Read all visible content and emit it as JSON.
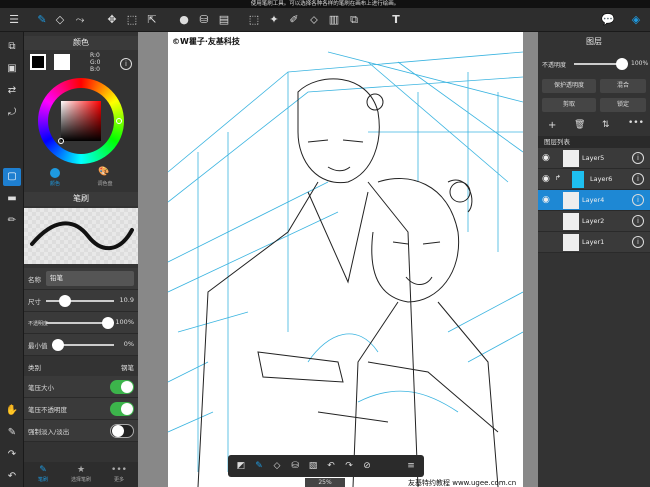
{
  "hint_bar": "使用笔刷工具。可以选择各种各样的笔刷在画布上进行绘画。",
  "toolbar": {
    "menu_icon": "menu-icon",
    "tools": [
      "brush-icon",
      "eraser-icon",
      "smudge-icon",
      "move-icon",
      "transform-icon",
      "export-icon",
      "fill-icon",
      "bucket-icon",
      "gradient-icon",
      "select-rect-icon",
      "magic-wand-icon",
      "select-pen-icon",
      "select-eraser-icon",
      "crop-icon",
      "text-icon"
    ],
    "right": [
      "chat-icon",
      "layers-icon"
    ]
  },
  "color_panel": {
    "title": "颜色",
    "r": "R:0",
    "g": "G:0",
    "b": "B:0",
    "tab_color": "颜色",
    "tab_palette": "调色盘"
  },
  "brush_panel": {
    "title": "笔刷",
    "name_label": "名称",
    "name_value": "铅笔",
    "size_label": "尺寸",
    "size_value": "10.9",
    "size_fraction": 0.28,
    "opacity_label": "不透明度",
    "opacity_value": "100%",
    "opacity_fraction": 1.0,
    "min_label": "最小值",
    "min_value": "0%",
    "min_fraction": 0.0,
    "type_label": "类别",
    "type_value": "钢笔",
    "pressure_size_label": "笔压大小",
    "pressure_size_on": true,
    "pressure_opacity_label": "笔压不透明度",
    "pressure_opacity_on": true,
    "fade_label": "强制淡入/淡出",
    "fade_on": false
  },
  "bottom_tabs": [
    {
      "label": "笔刷",
      "icon": "brush-icon"
    },
    {
      "label": "选择笔刷",
      "icon": "star-icon"
    },
    {
      "label": "更多",
      "icon": "more-icon"
    }
  ],
  "canvas": {
    "watermark": "©W瞿子·友基科技",
    "footer": "友基特约教程 www.ugee.com.cn",
    "zoom": "25%"
  },
  "layers_panel": {
    "title": "图层",
    "opacity_label": "不透明度",
    "opacity_value": "100%",
    "opacity_fraction": 1.0,
    "protect_alpha": "保护透明度",
    "blend": "混合",
    "clip": "剪取",
    "lock": "锁定",
    "list_title": "图层列表",
    "layers": [
      {
        "name": "Layer5",
        "visible": true,
        "selected": false
      },
      {
        "name": "Layer6",
        "visible": true,
        "selected": false
      },
      {
        "name": "Layer4",
        "visible": true,
        "selected": true
      },
      {
        "name": "Layer2",
        "visible": false,
        "selected": false
      },
      {
        "name": "Layer1",
        "visible": false,
        "selected": false
      }
    ]
  },
  "colors": {
    "accent": "#1e9ae0",
    "toggle_on": "#3cb44b"
  }
}
